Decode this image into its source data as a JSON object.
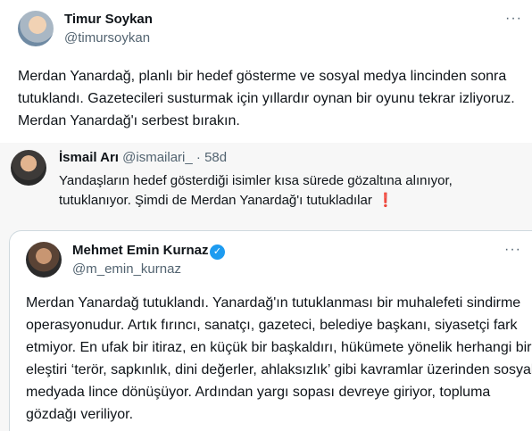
{
  "main_tweet": {
    "name": "Timur Soykan",
    "handle": "@timursoykan",
    "more_icon": "more-horizontal-icon",
    "text": "Merdan Yanardağ, planlı bir hedef gösterme ve sosyal medya lincinden sonra tutuklandı. Gazetecileri susturmak için yıllardır oynan bir oyunu tekrar izliyoruz. Merdan Yanardağ'ı serbest bırakın."
  },
  "quoted_tweet": {
    "name": "İsmail Arı",
    "handle": "@ismailari_",
    "separator": " · ",
    "time": "58d",
    "text": "Yandaşların hedef gösterdiği isimler kısa sürede gözaltına alınıyor, tutuklanıyor. Şimdi de Merdan Yanardağ'ı tutukladılar",
    "emoji": "❗"
  },
  "embedded_card": {
    "name": "Mehmet Emin Kurnaz",
    "handle": "@m_emin_kurnaz",
    "verified": "✓",
    "more_icon": "more-horizontal-icon",
    "text": "Merdan Yanardağ tutuklandı. Yanardağ'ın tutuklanması bir muhalefeti sindirme operasyonudur. Artık fırıncı, sanatçı, gazeteci, belediye başkanı, siyasetçi fark etmiyor. En ufak bir itiraz, en küçük bir başkaldırı, hükümete yönelik herhangi bir eleştiri ‘terör, sapkınlık, dini değerler, ahlaksızlık’ gibi kavramlar üzerinden sosyal medyada lince dönüşüyor. Ardından yargı sopası devreye giriyor, topluma gözdağı veriliyor."
  },
  "ui": {
    "more_glyph": "···"
  },
  "colors": {
    "text": "#0f1419",
    "secondary": "#536471",
    "verified": "#1d9bf0",
    "quote_bg": "#f7f7f7",
    "border": "#cfd9de",
    "emoji": "#e0245e"
  }
}
